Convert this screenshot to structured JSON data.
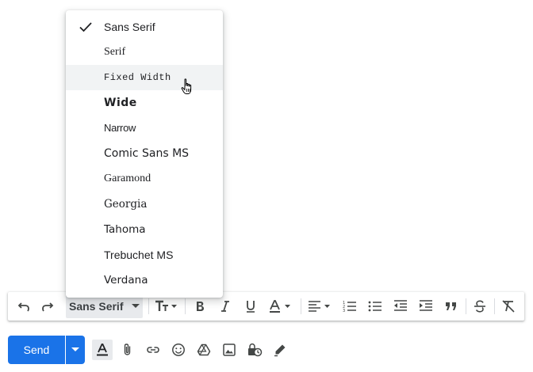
{
  "font_menu": {
    "selected": "Sans Serif",
    "hovered": "Fixed Width",
    "items": [
      {
        "label": "Sans Serif"
      },
      {
        "label": "Serif"
      },
      {
        "label": "Fixed Width"
      },
      {
        "label": "Wide"
      },
      {
        "label": "Narrow"
      },
      {
        "label": "Comic Sans MS"
      },
      {
        "label": "Garamond"
      },
      {
        "label": "Georgia"
      },
      {
        "label": "Tahoma"
      },
      {
        "label": "Trebuchet MS"
      },
      {
        "label": "Verdana"
      }
    ]
  },
  "toolbar": {
    "font_select_value": "Sans Serif",
    "buttons": [
      "undo-icon",
      "redo-icon",
      "text-size-icon",
      "bold-icon",
      "italic-icon",
      "underline-icon",
      "text-color-icon",
      "align-icon",
      "numbered-list-icon",
      "bulleted-list-icon",
      "indent-less-icon",
      "indent-more-icon",
      "quote-icon",
      "strikethrough-icon",
      "remove-formatting-icon"
    ]
  },
  "bottom_bar": {
    "send_label": "Send",
    "buttons": [
      "formatting-options-icon",
      "attach-file-icon",
      "insert-link-icon",
      "emoji-icon",
      "drive-icon",
      "insert-photo-icon",
      "confidential-mode-icon",
      "signature-icon"
    ]
  },
  "colors": {
    "accent": "#1a73e8",
    "icon": "#444746",
    "hover_bg": "#f1f3f4",
    "select_bg": "#e8eaed"
  }
}
